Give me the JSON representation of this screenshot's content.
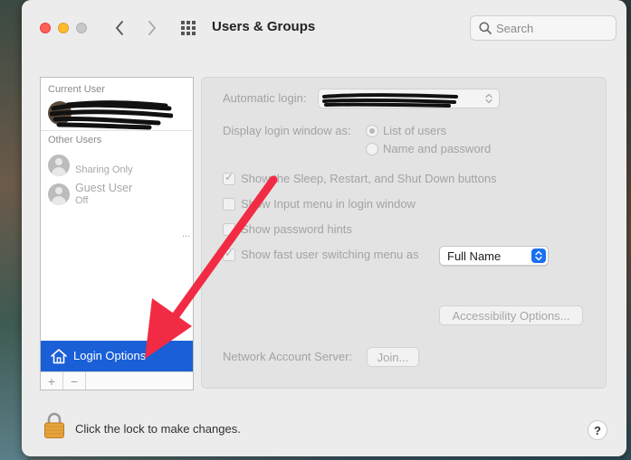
{
  "window": {
    "title": "Users & Groups"
  },
  "search": {
    "placeholder": "Search"
  },
  "sidebar": {
    "current_user_label": "Current User",
    "other_users_label": "Other Users",
    "users": [
      {
        "name": "",
        "sub": "Sharing Only"
      },
      {
        "name": "Guest User",
        "sub": "Off"
      }
    ],
    "ellipsis": "...",
    "login_options_label": "Login Options",
    "add_label": "+",
    "remove_label": "−"
  },
  "panel": {
    "automatic_login_label": "Automatic login:",
    "display_login_label": "Display login window as:",
    "radio_list": "List of users",
    "radio_name": "Name and password",
    "radio_selected": "List of users",
    "checks": [
      {
        "label": "Show the Sleep, Restart, and Shut Down buttons",
        "checked": true
      },
      {
        "label": "Show Input menu in login window",
        "checked": false
      },
      {
        "label": "Show password hints",
        "checked": false
      },
      {
        "label": "Show fast user switching menu as",
        "checked": true
      }
    ],
    "fast_switch_value": "Full Name",
    "accessibility_button": "Accessibility Options...",
    "network_label": "Network Account Server:",
    "join_button": "Join..."
  },
  "footer": {
    "lock_text": "Click the lock to make changes.",
    "help_label": "?"
  },
  "colors": {
    "selection_blue": "#1a5fd6",
    "arrow_red": "#f12b44"
  }
}
